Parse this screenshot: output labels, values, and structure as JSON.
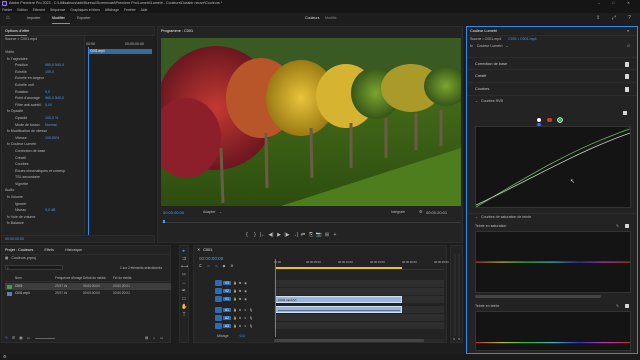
{
  "window": {
    "title": "Adobe Premiere Pro 2023 - C:\\Utilisateurs\\adri\\Bureau\\Screencast\\Premiere Pro\\Lumetri\\Lumetri - Couleurs\\Dossier neuve\\Couleurs *"
  },
  "menu": [
    "Fichier",
    "Edition",
    "Elément",
    "Séquence",
    "Graphiques et titres",
    "Affichage",
    "Fenêtre",
    "Aide"
  ],
  "workspaces": {
    "tabs": [
      "Importer",
      "Modifier",
      "Exporter"
    ],
    "active": "Modifier",
    "center": [
      "Couleurs",
      "Modifié"
    ]
  },
  "effects": {
    "tabs": [
      "Options d'effet",
      "Métadonnées",
      "Options du clip"
    ],
    "source_label": "Source > C001.mp4",
    "source_dropdown": "C001 • C001.mp4",
    "time_left": "00:00",
    "time_right": "00:00:00:00",
    "clip_name": "C001.mp4",
    "section_video": "Vidéo",
    "rows": [
      {
        "label": "fx Trajectoire",
        "values": ""
      },
      {
        "label": "Position",
        "values": "960,0   540,0"
      },
      {
        "label": "Echelle",
        "values": "100,0"
      },
      {
        "label": "Echelle en largeur",
        "values": ""
      },
      {
        "label": "Echelle unif.",
        "values": ""
      },
      {
        "label": "Rotation",
        "values": "0,0"
      },
      {
        "label": "Point d'ancrage",
        "values": "960,0   540,0"
      },
      {
        "label": "Filtre anti-scintill.",
        "values": "0,00"
      },
      {
        "label": "fx Opacité",
        "values": ""
      },
      {
        "label": "Opacité",
        "values": "100,0 %"
      },
      {
        "label": "Mode de fusion",
        "values": "Normal"
      },
      {
        "label": "fx Modification de vitesse",
        "values": ""
      },
      {
        "label": "Vitesse",
        "values": "100,00%"
      },
      {
        "label": "fx Couleur Lumetri",
        "values": ""
      },
      {
        "label": "Correction de base",
        "values": ""
      },
      {
        "label": "Créatif",
        "values": ""
      },
      {
        "label": "Courbes",
        "values": ""
      },
      {
        "label": "Roues chromatiques et corresp.",
        "values": ""
      },
      {
        "label": "TSL secondaire",
        "values": ""
      },
      {
        "label": "Vignette",
        "values": ""
      }
    ],
    "section_audio": "Audio",
    "audio_rows": [
      {
        "label": "fx Volume",
        "values": ""
      },
      {
        "label": "Ignorer",
        "values": ""
      },
      {
        "label": "Niveau",
        "values": "0,0 dB"
      },
      {
        "label": "fx Voie de volume",
        "values": ""
      },
      {
        "label": "fx Balance",
        "values": ""
      }
    ],
    "bottom_time": "00:00:00:00"
  },
  "program": {
    "tab": "Programme : C001",
    "timecode": "00:00:00:00",
    "fit": "Adapter",
    "quality": "Intégrale",
    "duration": "00:00:20:01",
    "controls": [
      "{",
      "}",
      "|←",
      "◀|",
      "▶",
      "|▶",
      "→|",
      "⇄",
      "⎘",
      "📷",
      "⊞",
      "+"
    ]
  },
  "lumetri": {
    "tabs": [
      "Couleur Lumetri"
    ],
    "source_label": "Source • C001.mp4",
    "sequence_label": "C001 • C001.mp4",
    "effect_name": "Couleur Lumetri",
    "sections": [
      "Correction de base",
      "Créatif",
      "Courbes"
    ],
    "curves_rgb_label": "Courbes RVB",
    "channel_colors": [
      "#ffffff",
      "#e03131",
      "#2fb34a",
      "#2f6bff"
    ],
    "hue_sat_label": "Courbes de saturation de teinte",
    "hue_vs_sat": "Teinte en saturation",
    "hue_vs_hue": "Teinte en teinte"
  },
  "project": {
    "tabs": [
      "Projet : Couleurs",
      "Effets",
      "Historique"
    ],
    "file": "Couleurs.prproj",
    "search_placeholder": "",
    "selection": "1 sur 2 éléments sélectionnés",
    "columns": [
      "Nom",
      "Fréquence d'image",
      "Début du média",
      "Fin du média"
    ],
    "items": [
      {
        "name": "C001",
        "fps": "29,97 i/s",
        "start": "00:00:00:00",
        "end": "00:00:20:01",
        "selected": true
      },
      {
        "name": "C001.mp4",
        "fps": "29,97 i/s",
        "start": "00:00:00:00",
        "end": "00:00:20:01",
        "selected": false
      }
    ]
  },
  "timeline": {
    "tab": "C001",
    "timecode": "00:00:00:00",
    "ruler": [
      "00:00",
      "00:00:05:00",
      "00:00:10:00",
      "00:00:15:00",
      "00:00:20:00",
      "00:00:25:00"
    ],
    "tracks_video": [
      "V3",
      "V2",
      "V1"
    ],
    "tracks_audio": [
      "A1",
      "A2",
      "A3"
    ],
    "mix_label": "Mixage",
    "mix_value": "0,0",
    "video_clip": "C001.mp4 [V]",
    "audio_clip": ""
  }
}
